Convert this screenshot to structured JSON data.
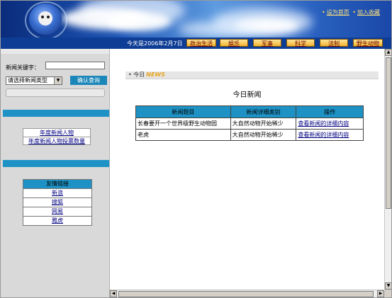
{
  "header": {
    "top_links": [
      "设为首页",
      "加入收藏"
    ],
    "date_text": "今天是2006年2月7日",
    "nav": [
      "政治生活",
      "娱乐",
      "军事",
      "科学",
      "法制",
      "野生动物"
    ]
  },
  "sidebar": {
    "keyword_label": "新闻关键字：",
    "keyword_value": "",
    "type_select_value": "请选择新闻类型",
    "confirm_button": "确认查询",
    "stats_links": [
      "年度新闻人物",
      "年度新闻人物投票数量"
    ],
    "friend_links_title": "友情链接",
    "friend_links": [
      "新浪",
      "搜狐",
      "网易",
      "雅虎"
    ]
  },
  "main": {
    "breadcrumb": "• 今日",
    "breadcrumb_tag": "NEWS",
    "title": "今日新闻",
    "table": {
      "headers": [
        "新闻题目",
        "新闻详细类别",
        "操作"
      ],
      "rows": [
        [
          "长春要开一个世界级野生动物园",
          "大自然动物开始稀少",
          "查看新闻的详细内容"
        ],
        [
          "老虎",
          "大自然动物开始稀少",
          "查看新闻的详细内容"
        ]
      ]
    }
  },
  "colors": {
    "accent": "#1e92c4",
    "nav_bar": "#0e3d96",
    "nav_button": "#f2b430",
    "link": "#000080"
  }
}
